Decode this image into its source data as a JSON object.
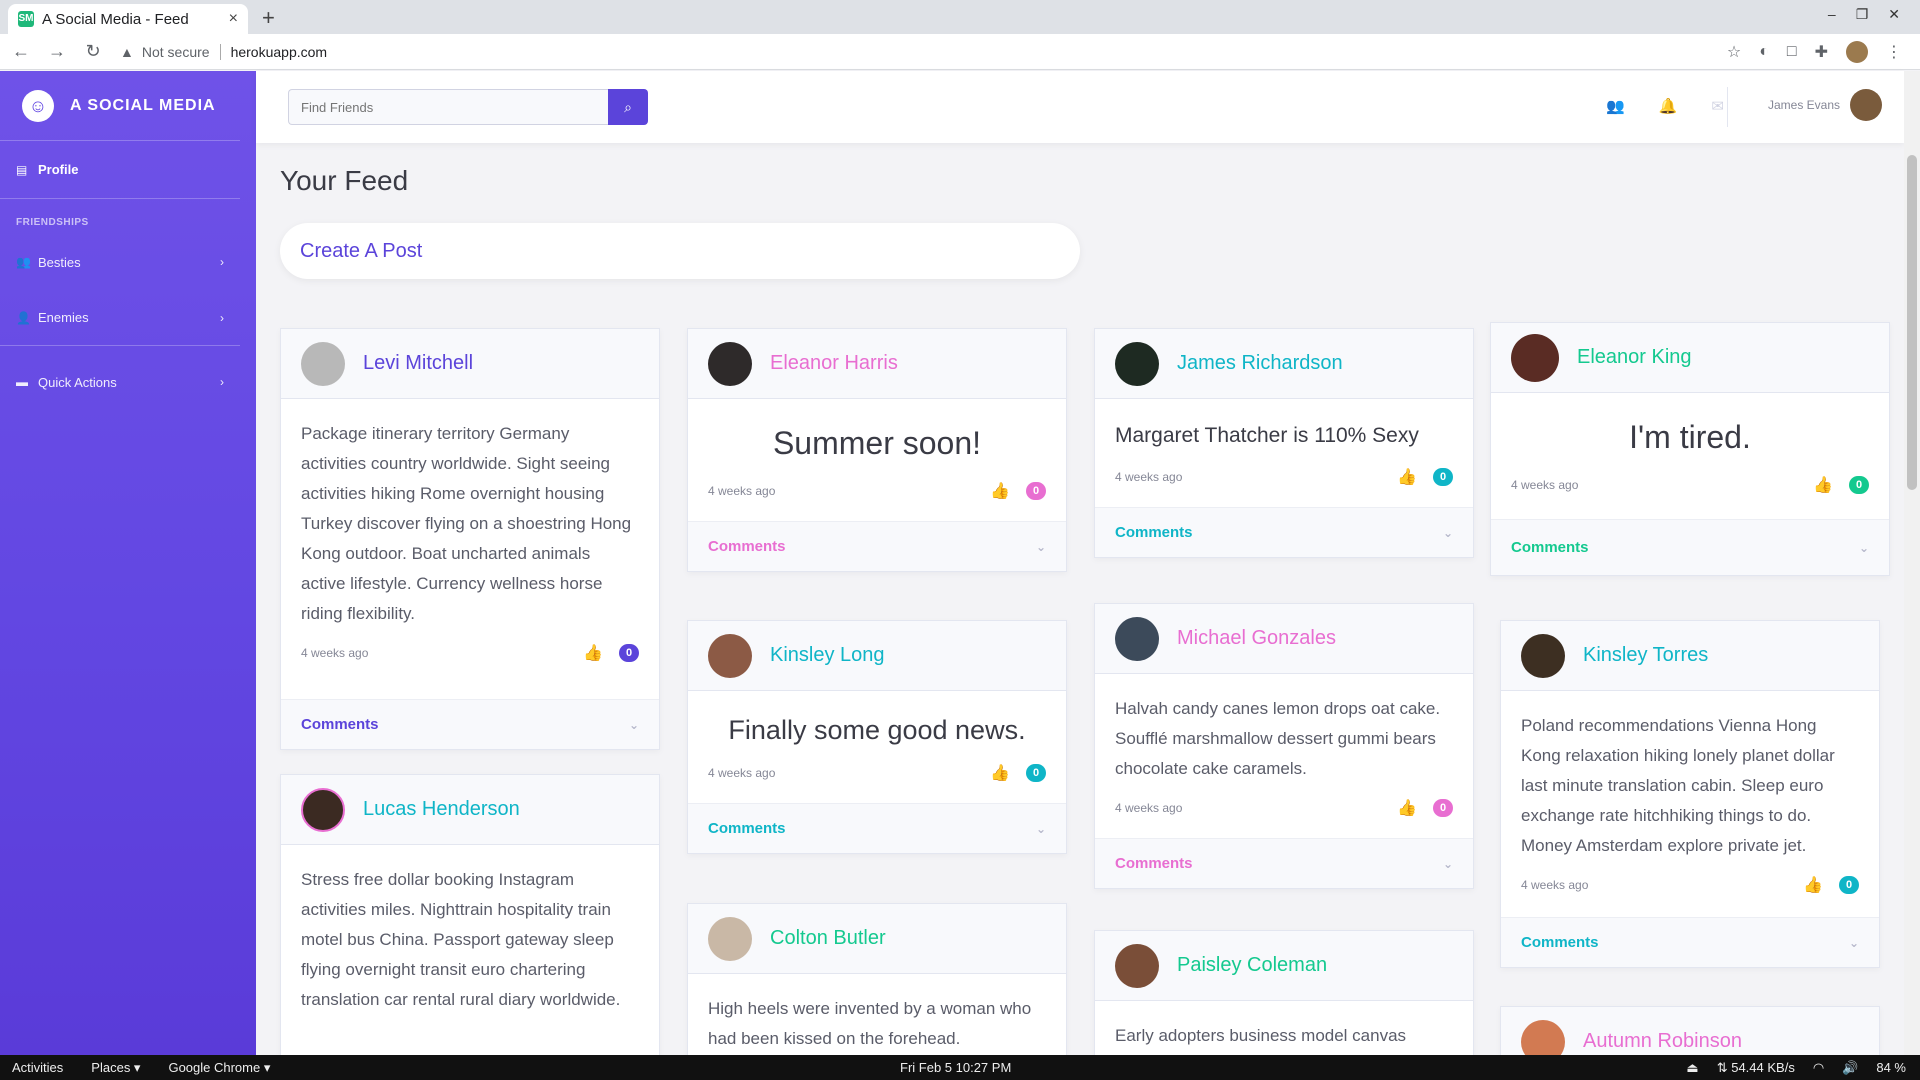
{
  "browser": {
    "tab_title": "A Social Media - Feed",
    "tab_favicon": "SM",
    "tab_close": "×",
    "new_tab": "+",
    "not_secure": "Not secure",
    "url": "herokuapp.com"
  },
  "sidebar": {
    "brand": "A SOCIAL MEDIA",
    "profile": "Profile",
    "friendships_heading": "FRIENDSHIPS",
    "besties": "Besties",
    "enemies": "Enemies",
    "quick_actions": "Quick Actions"
  },
  "topbar": {
    "search_placeholder": "Find Friends",
    "user_name": "James Evans"
  },
  "main": {
    "title": "Your Feed",
    "create_post": "Create A Post",
    "comments_label": "Comments"
  },
  "posts": [
    {
      "author": "Levi Mitchell",
      "text": "Package itinerary territory Germany activities country worldwide. Sight seeing activities hiking Rome overnight housing Turkey discover flying on a shoestring Hong Kong outdoor. Boat uncharted animals active lifestyle. Currency wellness horse riding flexibility.",
      "time": "4 weeks ago",
      "likes": "0",
      "color": "#5b44da"
    },
    {
      "author": "Lucas Henderson",
      "text": "Stress free dollar booking Instagram activities miles. Nighttrain hospitality train motel bus China. Passport gateway sleep flying overnight transit euro chartering translation car rental rural diary worldwide.",
      "color": "#0fb5c7"
    },
    {
      "author": "Eleanor Harris",
      "text": "Summer soon!",
      "time": "4 weeks ago",
      "likes": "0",
      "color": "#e86ed1"
    },
    {
      "author": "Kinsley Long",
      "text": "Finally some good news.",
      "time": "4 weeks ago",
      "likes": "0",
      "color": "#0fb5c7"
    },
    {
      "author": "Colton Butler",
      "text": "High heels were invented by a woman who had been kissed on the forehead.",
      "color": "#14c98f"
    },
    {
      "author": "James Richardson",
      "text": "Margaret Thatcher is 110% Sexy",
      "time": "4 weeks ago",
      "likes": "0",
      "color": "#0fb5c7"
    },
    {
      "author": "Michael Gonzales",
      "text": "Halvah candy canes lemon drops oat cake. Soufflé marshmallow dessert gummi bears chocolate cake caramels.",
      "time": "4 weeks ago",
      "likes": "0",
      "color": "#e86ed1"
    },
    {
      "author": "Paisley Coleman",
      "text": "Early adopters business model canvas",
      "color": "#14c98f"
    },
    {
      "author": "Eleanor King",
      "text": "I'm tired.",
      "time": "4 weeks ago",
      "likes": "0",
      "color": "#14c98f"
    },
    {
      "author": "Kinsley Torres",
      "text": "Poland recommendations Vienna Hong Kong relaxation hiking lonely planet dollar last minute translation cabin. Sleep euro exchange rate hitchhiking things to do. Money Amsterdam explore private jet.",
      "time": "4 weeks ago",
      "likes": "0",
      "color": "#0fb5c7"
    },
    {
      "author": "Autumn Robinson",
      "color": "#e86ed1"
    }
  ],
  "taskbar": {
    "activities": "Activities",
    "places": "Places ▾",
    "app": "Google Chrome ▾",
    "clock": "Fri Feb 5  10:27 PM",
    "net": "⇅ 54.44 KB/s",
    "battery": "84 %"
  }
}
